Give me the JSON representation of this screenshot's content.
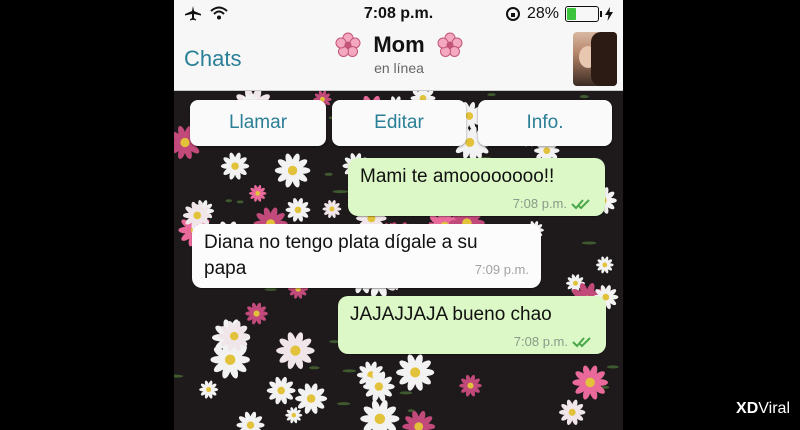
{
  "status_bar": {
    "time": "7:08 p.m.",
    "battery_percent": "28%",
    "battery_level": 0.28,
    "battery_color": "#3cc43c",
    "icons": [
      "airplane-icon",
      "wifi-icon",
      "rotation-lock-icon",
      "charging-bolt-icon"
    ]
  },
  "nav": {
    "back_label": "Chats",
    "contact_name": "Mom",
    "contact_status": "en línea",
    "decor_icon": "flower-icon"
  },
  "actions": [
    {
      "label": "Llamar"
    },
    {
      "label": "Editar"
    },
    {
      "label": "Info."
    }
  ],
  "messages": [
    {
      "direction": "out",
      "line1": "Mami te amoooooooo!!",
      "line2": "",
      "time": "7:08 p.m.",
      "read": true
    },
    {
      "direction": "in",
      "line1": "Diana no tengo plata dígale a su",
      "line2": "papa",
      "time": "7:09 p.m.",
      "read": false
    },
    {
      "direction": "out",
      "line1": "JAJAJJAJA bueno chao",
      "line2": "",
      "time": "7:08 p.m.",
      "read": true
    }
  ],
  "watermark": {
    "part1": "XD",
    "part2": "Viral"
  },
  "colors": {
    "accent": "#2a7f96",
    "outgoing_bubble": "#dcf8c6",
    "read_ticks": "#4aa84a"
  }
}
